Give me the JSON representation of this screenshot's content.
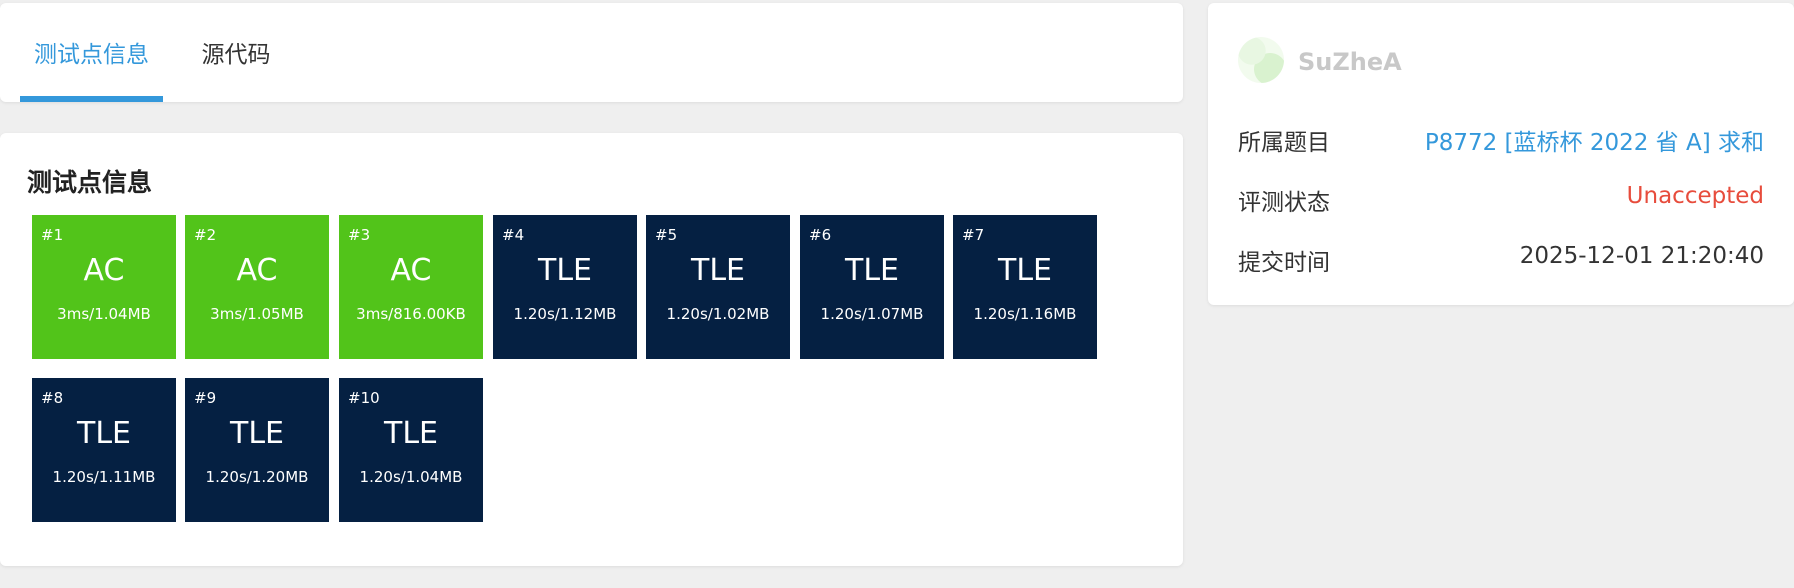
{
  "tabs": [
    {
      "label": "测试点信息"
    },
    {
      "label": "源代码"
    }
  ],
  "cases_title": "测试点信息",
  "testcases": [
    {
      "num": "#1",
      "status": "AC",
      "info": "3ms/1.04MB"
    },
    {
      "num": "#2",
      "status": "AC",
      "info": "3ms/1.05MB"
    },
    {
      "num": "#3",
      "status": "AC",
      "info": "3ms/816.00KB"
    },
    {
      "num": "#4",
      "status": "TLE",
      "info": "1.20s/1.12MB"
    },
    {
      "num": "#5",
      "status": "TLE",
      "info": "1.20s/1.02MB"
    },
    {
      "num": "#6",
      "status": "TLE",
      "info": "1.20s/1.07MB"
    },
    {
      "num": "#7",
      "status": "TLE",
      "info": "1.20s/1.16MB"
    },
    {
      "num": "#8",
      "status": "TLE",
      "info": "1.20s/1.11MB"
    },
    {
      "num": "#9",
      "status": "TLE",
      "info": "1.20s/1.20MB"
    },
    {
      "num": "#10",
      "status": "TLE",
      "info": "1.20s/1.04MB"
    }
  ],
  "side": {
    "username": "SuZheA",
    "problem_label": "所属题目",
    "problem_value": "P8772 [蓝桥杯 2022 省 A] 求和",
    "status_label": "评测状态",
    "status_value": "Unaccepted",
    "time_label": "提交时间",
    "time_value": "2025-12-01 21:20:40"
  },
  "colors": {
    "accent": "#3498db",
    "ac": "#52c41a",
    "tle": "#052042",
    "unaccepted": "#e74c3c"
  }
}
